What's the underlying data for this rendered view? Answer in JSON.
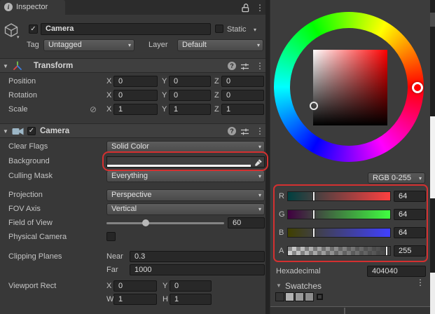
{
  "icons": {
    "info": "i",
    "help": "?",
    "kebab": "⋮",
    "foldout": "▼",
    "arrow": "▾",
    "check": "✓",
    "broken_link": "⊘"
  },
  "annotation_color": "#d43030",
  "inspector": {
    "tab": "Inspector",
    "header": {
      "name": "Camera",
      "static_label": "Static",
      "tag_label": "Tag",
      "tag_value": "Untagged",
      "layer_label": "Layer",
      "layer_value": "Default"
    },
    "axis": {
      "x": "X",
      "y": "Y",
      "z": "Z",
      "w": "W",
      "h": "H"
    },
    "transform": {
      "title": "Transform",
      "position": {
        "label": "Position",
        "x": "0",
        "y": "0",
        "z": "0"
      },
      "rotation": {
        "label": "Rotation",
        "x": "0",
        "y": "0",
        "z": "0"
      },
      "scale": {
        "label": "Scale",
        "x": "1",
        "y": "1",
        "z": "1"
      }
    },
    "camera": {
      "title": "Camera",
      "clear_flags_label": "Clear Flags",
      "clear_flags": "Solid Color",
      "background_label": "Background",
      "culling_mask_label": "Culling Mask",
      "culling_mask": "Everything",
      "projection_label": "Projection",
      "projection": "Perspective",
      "fov_axis_label": "FOV Axis",
      "fov_axis": "Vertical",
      "fov_label": "Field of View",
      "fov": "60",
      "physical_label": "Physical Camera",
      "clipping_label": "Clipping Planes",
      "near_label": "Near",
      "near": "0.3",
      "far_label": "Far",
      "far": "1000",
      "viewport_label": "Viewport Rect",
      "viewport": {
        "x": "0",
        "y": "0",
        "w": "1",
        "h": "1"
      }
    }
  },
  "color_picker": {
    "current_color": "#404040",
    "mode": "RGB 0-255",
    "sliders": [
      {
        "label": "R",
        "value": "64"
      },
      {
        "label": "G",
        "value": "64"
      },
      {
        "label": "B",
        "value": "64"
      },
      {
        "label": "A",
        "value": "255"
      }
    ],
    "hex_label": "Hexadecimal",
    "hex": "404040",
    "swatches_label": "Swatches",
    "swatch_colors": [
      "#353535",
      "#b2b2b2",
      "#999999",
      "#8d8d8d"
    ]
  }
}
